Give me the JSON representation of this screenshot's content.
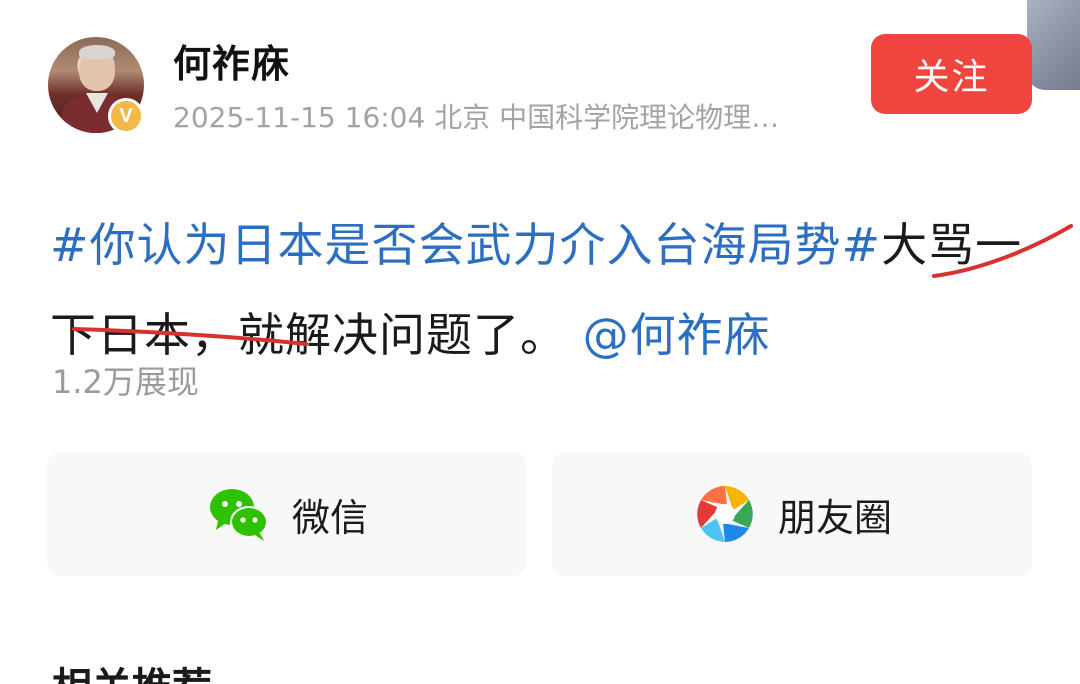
{
  "post_header": {
    "username": "何祚庥",
    "verified_badge": "V",
    "meta": "2025-11-15 16:04 北京 中国科学院理论物理…",
    "follow_label": "关注"
  },
  "post": {
    "topic": "#你认为日本是否会武力介入台海局势#",
    "body": "大骂一下日本，就解决问题了。",
    "mention": "@何祚庥"
  },
  "stats": {
    "views": "1.2万展现"
  },
  "share": {
    "wechat_label": "微信",
    "moments_label": "朋友圈"
  },
  "section": {
    "related_label": "相关推荐"
  },
  "colors": {
    "topic_link": "#2c6fc0",
    "follow_button": "#f1453f",
    "scribble": "#d8322e",
    "badge": "#f3b847"
  },
  "icons": [
    "verified-icon",
    "wechat-icon",
    "moments-icon"
  ]
}
